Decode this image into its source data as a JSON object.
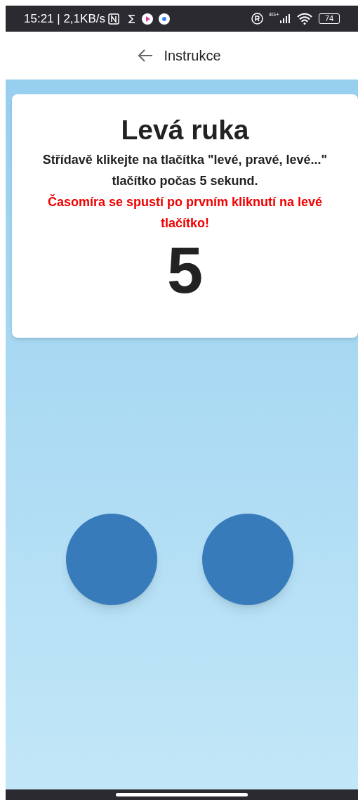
{
  "status_bar": {
    "time_speed": "15:21 | 2,1KB/s",
    "network": "4G+",
    "battery": "74"
  },
  "header": {
    "title": "Instrukce"
  },
  "card": {
    "title": "Levá ruka",
    "instruction": "Střídavě klikejte na tlačítka \"levé, pravé, levé...\" tlačítko počas 5 sekund.",
    "warning": "Časomíra se spustí po prvním kliknutí na levé tlačítko!",
    "countdown": "5"
  }
}
